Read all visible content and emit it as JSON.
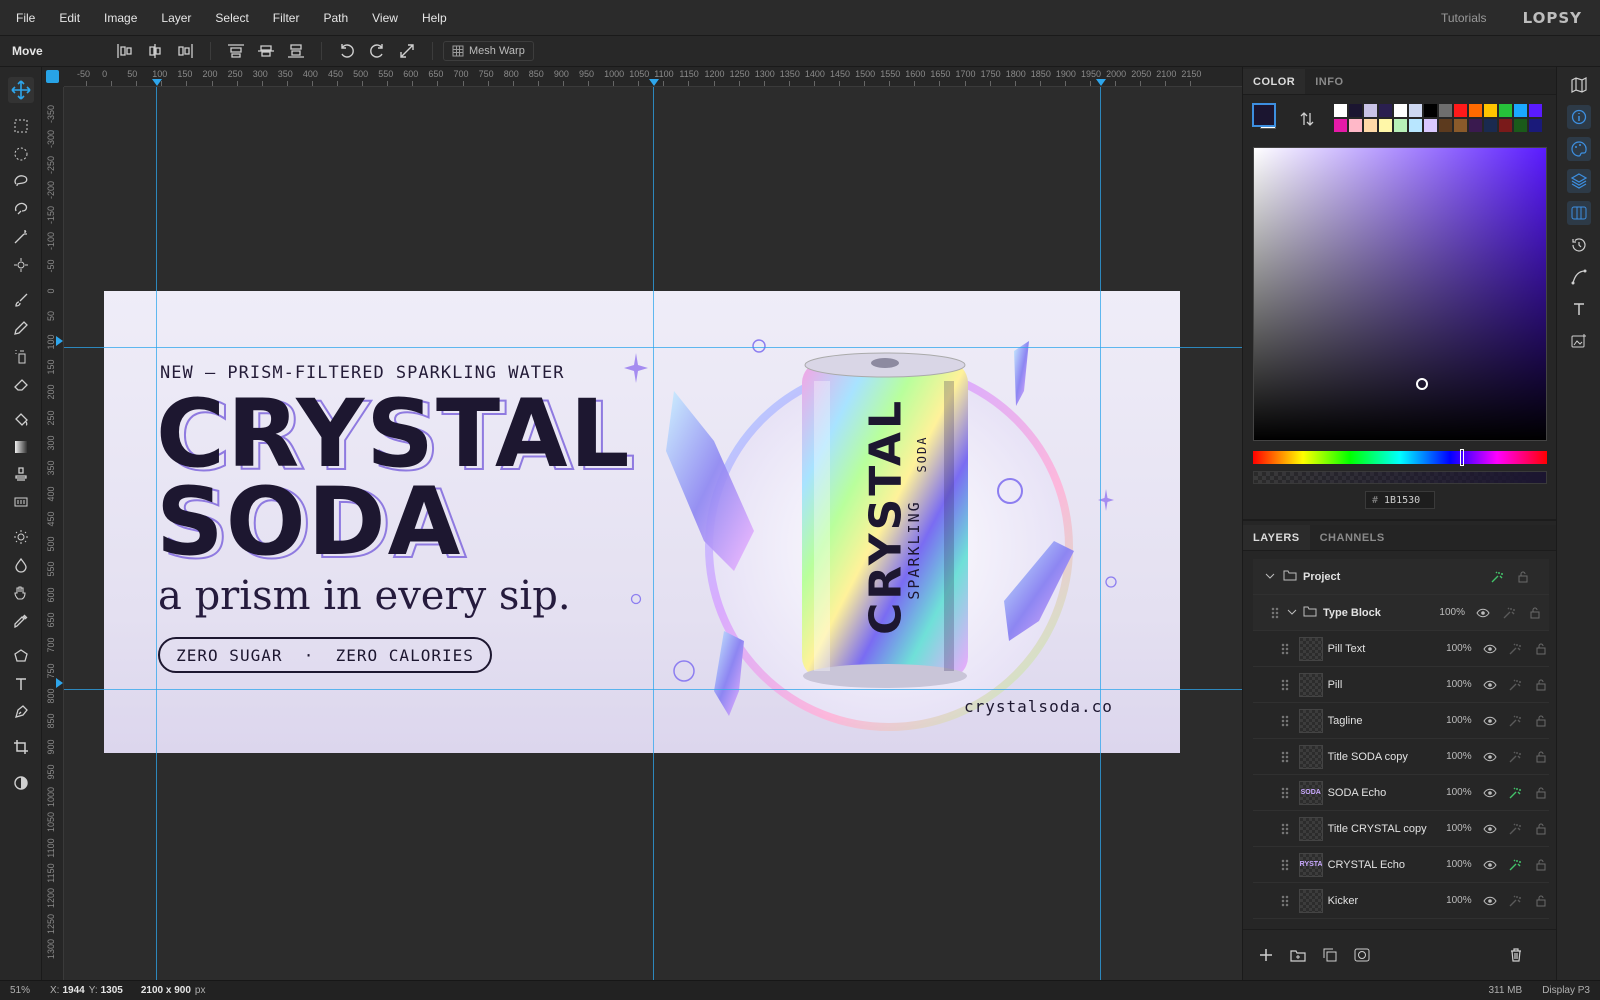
{
  "menu": [
    "File",
    "Edit",
    "Image",
    "Layer",
    "Select",
    "Filter",
    "Path",
    "View",
    "Help"
  ],
  "header": {
    "tutorials": "Tutorials",
    "logo": "LOPSY"
  },
  "options": {
    "tool_name": "Move",
    "mesh_warp": "Mesh Warp"
  },
  "ruler": {
    "h_labels": [
      "-50",
      "0",
      "50",
      "100",
      "150",
      "200",
      "250",
      "300",
      "350",
      "400",
      "450",
      "500",
      "550",
      "600",
      "650",
      "700",
      "750",
      "800",
      "850",
      "900",
      "950",
      "1000",
      "1050",
      "1100",
      "1150",
      "1200",
      "1250",
      "1300",
      "1350",
      "1400",
      "1450",
      "1500",
      "1550",
      "1600",
      "1650",
      "1700",
      "1750",
      "1800",
      "1850",
      "1900",
      "1950",
      "2000",
      "2050",
      "2100",
      "2150"
    ],
    "v_labels": [
      "-350",
      "-300",
      "-250",
      "-200",
      "-150",
      "-100",
      "-50",
      "0",
      "50",
      "100",
      "150",
      "200",
      "250",
      "300",
      "350",
      "400",
      "450",
      "500",
      "550",
      "600",
      "650",
      "700",
      "750",
      "800",
      "850",
      "900",
      "950",
      "1000",
      "1050",
      "1100",
      "1150",
      "1200",
      "1250",
      "1300"
    ]
  },
  "canvas": {
    "kicker": "NEW  —  PRISM-FILTERED SPARKLING WATER",
    "title_line1": "CRYSTAL",
    "title_line2": "SODA",
    "tagline": "a prism in every sip.",
    "pill": "ZERO SUGAR  ·  ZERO CALORIES",
    "url": "crystalsoda.co",
    "can_brand": "CRYSTAL",
    "can_sub1": "SPARKLING",
    "can_sub2": "SODA"
  },
  "color_panel": {
    "tabs": [
      "COLOR",
      "INFO"
    ],
    "hex_prefix": "#",
    "hex_value": "1B1530",
    "foreground": "#1b1530",
    "swatches": [
      "#ffffff",
      "#1b1530",
      "#c9c3e6",
      "#2a1f4f",
      "#ffffff",
      "#cdd7f0",
      "#000000",
      "#6e6e6e",
      "#ff1a1a",
      "#ff6a00",
      "#ffc400",
      "#26c13a",
      "#1aa8ff",
      "#5a1bff",
      "#e61aa8",
      "#ffb8c8",
      "#ffd9a8",
      "#fff7a8",
      "#b8f0b8",
      "#b8e6ff",
      "#d9c8ff",
      "#5c3a1e",
      "#8a5a2a",
      "#3a1a4f",
      "#1a2a4f",
      "#7a1a1a",
      "#1a5a1a",
      "#1a1a7a"
    ]
  },
  "layers_panel": {
    "tabs": [
      "LAYERS",
      "CHANNELS"
    ],
    "rows": [
      {
        "name": "Project",
        "opacity": "",
        "thumb": "",
        "kind": "root"
      },
      {
        "name": "Type Block",
        "opacity": "100%",
        "thumb": "",
        "kind": "group"
      },
      {
        "name": "Pill Text",
        "opacity": "100%",
        "thumb": "",
        "kind": "layer"
      },
      {
        "name": "Pill",
        "opacity": "100%",
        "thumb": "",
        "kind": "layer"
      },
      {
        "name": "Tagline",
        "opacity": "100%",
        "thumb": "",
        "kind": "layer"
      },
      {
        "name": "Title SODA copy",
        "opacity": "100%",
        "thumb": "",
        "kind": "layer"
      },
      {
        "name": "SODA Echo",
        "opacity": "100%",
        "thumb": "SODA",
        "kind": "fx"
      },
      {
        "name": "Title CRYSTAL copy",
        "opacity": "100%",
        "thumb": "",
        "kind": "layer"
      },
      {
        "name": "CRYSTAL Echo",
        "opacity": "100%",
        "thumb": "CRYSTAL",
        "kind": "fx"
      },
      {
        "name": "Kicker",
        "opacity": "100%",
        "thumb": "",
        "kind": "layer"
      }
    ]
  },
  "status": {
    "zoom": "51%",
    "x_label": "X:",
    "x": "1944",
    "y_label": "Y:",
    "y": "1305",
    "doc_size": "2100 x 900",
    "doc_unit": "px",
    "memory": "311 MB",
    "profile": "Display P3"
  },
  "icons": {
    "tools": [
      "move-icon",
      "rect-select-icon",
      "ellipse-select-icon",
      "lasso-icon",
      "magnetic-lasso-icon",
      "magic-wand-icon",
      "quick-select-icon",
      "brush-icon",
      "pencil-icon",
      "spray-icon",
      "eraser-icon",
      "paint-bucket-icon",
      "gradient-icon",
      "stamp-icon",
      "healing-icon",
      "dodge-icon",
      "burn-icon",
      "hand-icon",
      "eyedropper-icon",
      "polygon-icon",
      "text-icon",
      "pen-icon",
      "crop-icon",
      "contrast-icon"
    ],
    "strip": [
      "map-icon",
      "info-icon",
      "palette-icon",
      "layers-icon",
      "columns-icon",
      "history-icon",
      "curve-icon",
      "type-icon",
      "image-edit-icon"
    ]
  }
}
